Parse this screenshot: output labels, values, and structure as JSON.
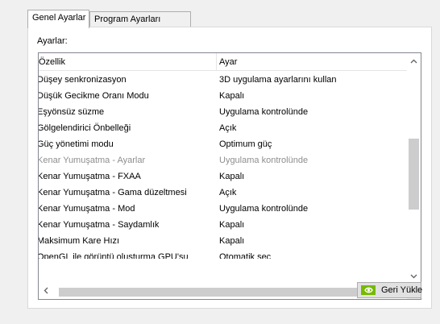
{
  "tabs": [
    {
      "label": "Genel Ayarlar",
      "active": true
    },
    {
      "label": "Program Ayarları",
      "active": false
    }
  ],
  "panel": {
    "label": "Ayarlar:"
  },
  "listview": {
    "columns": [
      "Özellik",
      "Ayar"
    ],
    "rows": [
      {
        "feature": "Düşey senkronizasyon",
        "value": "3D uygulama ayarlarını kullan",
        "disabled": false
      },
      {
        "feature": "Düşük Gecikme Oranı Modu",
        "value": "Kapalı",
        "disabled": false
      },
      {
        "feature": "Eşyönsüz süzme",
        "value": "Uygulama kontrolünde",
        "disabled": false
      },
      {
        "feature": "Gölgelendirici Önbelleği",
        "value": "Açık",
        "disabled": false
      },
      {
        "feature": "Güç yönetimi modu",
        "value": "Optimum güç",
        "disabled": false
      },
      {
        "feature": "Kenar Yumuşatma - Ayarlar",
        "value": "Uygulama kontrolünde",
        "disabled": true
      },
      {
        "feature": "Kenar Yumuşatma - FXAA",
        "value": "Kapalı",
        "disabled": false
      },
      {
        "feature": "Kenar Yumuşatma - Gama düzeltmesi",
        "value": "Açık",
        "disabled": false
      },
      {
        "feature": "Kenar Yumuşatma - Mod",
        "value": "Uygulama kontrolünde",
        "disabled": false
      },
      {
        "feature": "Kenar Yumuşatma - Saydamlık",
        "value": "Kapalı",
        "disabled": false
      },
      {
        "feature": "Maksimum Kare Hızı",
        "value": "Kapalı",
        "disabled": false
      },
      {
        "feature": "OpenGL ile görüntü oluşturma GPU'su",
        "value": "Otomatik seç",
        "disabled": false
      }
    ]
  },
  "buttons": {
    "reset_label": "Geri Yükle"
  },
  "icons": {
    "scroll_up": "chevron-up-icon",
    "scroll_down": "chevron-down-icon",
    "scroll_left": "chevron-left-icon",
    "scroll_right": "chevron-right-icon",
    "reset": "nvidia-logo-icon"
  },
  "colors": {
    "disabled_text": "#8e8e8e",
    "nvidia_green": "#76b900"
  }
}
